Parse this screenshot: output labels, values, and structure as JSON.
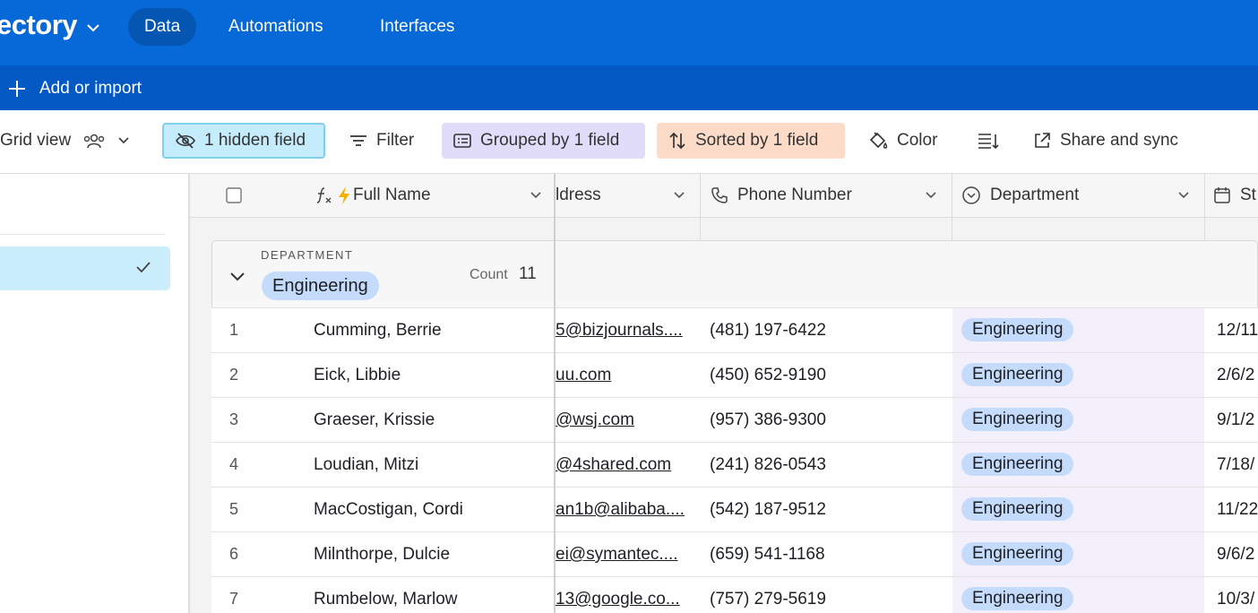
{
  "app": {
    "title": "ectory",
    "nav": [
      "Data",
      "Automations",
      "Interfaces"
    ],
    "active_nav": "Data"
  },
  "tablebar": {
    "add_import": "Add or import"
  },
  "toolbar": {
    "view_name": "Grid view",
    "hidden": "1 hidden field",
    "filter": "Filter",
    "grouped": "Grouped by 1 field",
    "sorted": "Sorted by 1 field",
    "color": "Color",
    "share": "Share and sync"
  },
  "columns": {
    "full_name": "Full Name",
    "email": "ldress",
    "phone": "Phone Number",
    "department": "Department",
    "date": "St"
  },
  "group": {
    "label": "DEPARTMENT",
    "value": "Engineering",
    "count_label": "Count",
    "count": "11"
  },
  "rows": [
    {
      "num": "1",
      "name": "Cumming, Berrie",
      "email": "5@bizjournals....",
      "phone": "(481) 197-6422",
      "dept": "Engineering",
      "date": "12/11"
    },
    {
      "num": "2",
      "name": "Eick, Libbie",
      "email": "uu.com",
      "phone": "(450) 652-9190",
      "dept": "Engineering",
      "date": "2/6/2"
    },
    {
      "num": "3",
      "name": "Graeser, Krissie",
      "email": "@wsj.com",
      "phone": "(957) 386-9300",
      "dept": "Engineering",
      "date": "9/1/2"
    },
    {
      "num": "4",
      "name": "Loudian, Mitzi",
      "email": "@4shared.com",
      "phone": "(241) 826-0543",
      "dept": "Engineering",
      "date": "7/18/"
    },
    {
      "num": "5",
      "name": "MacCostigan, Cordi",
      "email": "an1b@alibaba....",
      "phone": "(542) 187-9512",
      "dept": "Engineering",
      "date": "11/22"
    },
    {
      "num": "6",
      "name": "Milnthorpe, Dulcie",
      "email": "ei@symantec....",
      "phone": "(659) 541-1168",
      "dept": "Engineering",
      "date": "9/6/2"
    },
    {
      "num": "7",
      "name": "Rumbelow, Marlow",
      "email": "13@google.co...",
      "phone": "(757) 279-5619",
      "dept": "Engineering",
      "date": "10/3/"
    }
  ],
  "icons": {
    "title_chevron": "chevron-down-icon",
    "add": "plus-icon",
    "collaborators": "people-icon",
    "hidden": "eye-slash-icon",
    "filter": "filter-lines-icon",
    "grouped": "list-group-icon",
    "sorted": "sort-arrows-icon",
    "color": "paint-bucket-icon",
    "row_height": "row-height-icon",
    "share": "external-link-icon",
    "formula": "formula-icon",
    "lightning": "lightning-icon",
    "phone": "phone-icon",
    "department": "single-select-icon",
    "calendar": "calendar-icon",
    "check": "checkmark-icon"
  },
  "colors": {
    "topbar": "#0768d8",
    "tablebar": "#0559c4",
    "hidden_bg": "#c4ecfd",
    "grouped_bg": "#e0dcfa",
    "sorted_bg": "#fcdcc8",
    "badge_bg": "#c5dbfb"
  }
}
